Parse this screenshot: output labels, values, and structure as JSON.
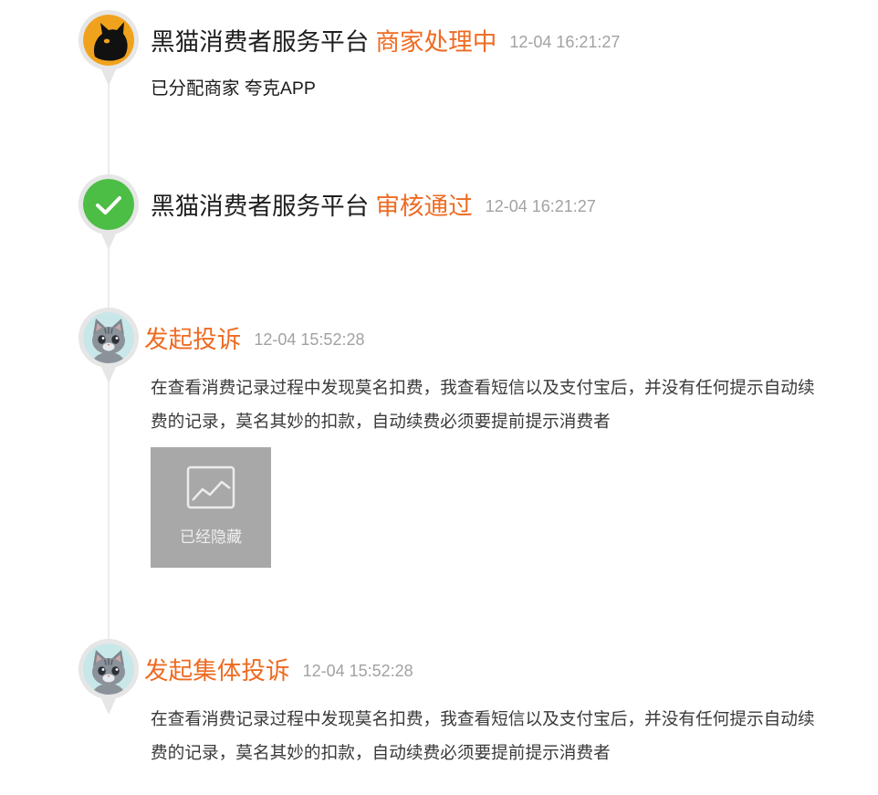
{
  "colors": {
    "accent": "#ee6b22",
    "check": "#4cbd45",
    "timeline_line": "#ececec"
  },
  "timeline": [
    {
      "avatar_icon": "black-cat-logo",
      "author": "黑猫消费者服务平台",
      "status": "商家处理中",
      "time": "12-04 16:21:27",
      "content": "已分配商家 夸克APP"
    },
    {
      "avatar_icon": "check-icon",
      "author": "黑猫消费者服务平台",
      "status": "审核通过",
      "time": "12-04 16:21:27"
    },
    {
      "avatar_icon": "cat-avatar",
      "status": "发起投诉",
      "time": "12-04 15:52:28",
      "content": "在查看消费记录过程中发现莫名扣费，我查看短信以及支付宝后，并没有任何提示自动续费的记录，莫名其妙的扣款，自动续费必须要提前提示消费者",
      "attachment": {
        "icon": "image-icon",
        "label": "已经隐藏"
      }
    },
    {
      "avatar_icon": "cat-avatar",
      "status": "发起集体投诉",
      "time": "12-04 15:52:28",
      "content": "在查看消费记录过程中发现莫名扣费，我查看短信以及支付宝后，并没有任何提示自动续费的记录，莫名其妙的扣款，自动续费必须要提前提示消费者"
    }
  ]
}
